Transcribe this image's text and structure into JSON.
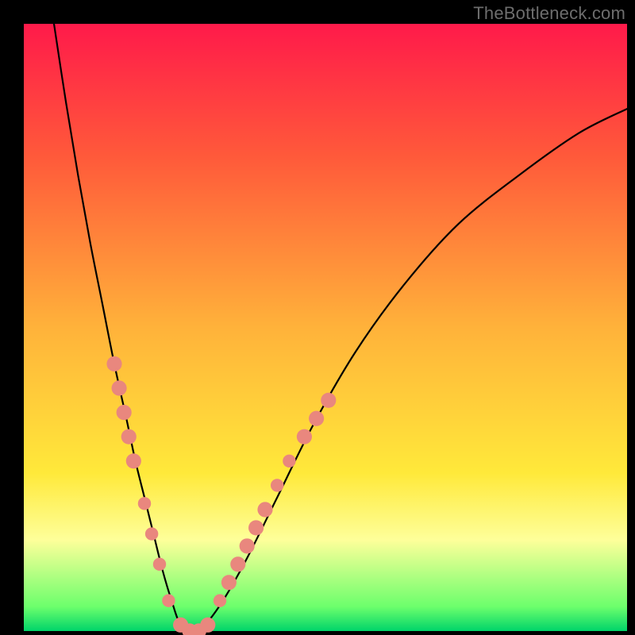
{
  "watermark": "TheBottleneck.com",
  "colors": {
    "top": "#ff1a4a",
    "upper": "#ff5a3a",
    "mid": "#ffb23a",
    "low": "#ffe93a",
    "pale": "#feff9a",
    "green1": "#6cff6c",
    "green2": "#00d46a",
    "curve": "#000000",
    "dot": "#e9877e"
  },
  "chart_data": {
    "type": "line",
    "title": "",
    "xlabel": "",
    "ylabel": "",
    "xlim": [
      0,
      100
    ],
    "ylim": [
      0,
      100
    ],
    "grid": false,
    "legend": false,
    "annotations": [],
    "series": [
      {
        "name": "bottleneck-curve",
        "x": [
          5,
          7,
          9,
          11,
          13,
          15,
          17,
          18.5,
          20,
          21.5,
          23,
          24.5,
          26,
          28,
          30,
          33,
          37,
          42,
          48,
          55,
          63,
          72,
          82,
          92,
          100
        ],
        "values": [
          100,
          87,
          75,
          64,
          54,
          44,
          35,
          28,
          22,
          16,
          10,
          5,
          1,
          0,
          1,
          5,
          12,
          22,
          34,
          46,
          57,
          67,
          75,
          82,
          86
        ]
      }
    ],
    "markers": [
      {
        "series": "bottleneck-curve",
        "x": 15.0,
        "y": 44,
        "r": 1.4
      },
      {
        "series": "bottleneck-curve",
        "x": 15.8,
        "y": 40,
        "r": 1.4
      },
      {
        "series": "bottleneck-curve",
        "x": 16.6,
        "y": 36,
        "r": 1.4
      },
      {
        "series": "bottleneck-curve",
        "x": 17.4,
        "y": 32,
        "r": 1.4
      },
      {
        "series": "bottleneck-curve",
        "x": 18.2,
        "y": 28,
        "r": 1.4
      },
      {
        "series": "bottleneck-curve",
        "x": 20.0,
        "y": 21,
        "r": 1.2
      },
      {
        "series": "bottleneck-curve",
        "x": 21.2,
        "y": 16,
        "r": 1.2
      },
      {
        "series": "bottleneck-curve",
        "x": 22.5,
        "y": 11,
        "r": 1.2
      },
      {
        "series": "bottleneck-curve",
        "x": 24.0,
        "y": 5,
        "r": 1.2
      },
      {
        "series": "bottleneck-curve",
        "x": 26.0,
        "y": 1,
        "r": 1.4
      },
      {
        "series": "bottleneck-curve",
        "x": 27.5,
        "y": 0,
        "r": 1.4
      },
      {
        "series": "bottleneck-curve",
        "x": 29.0,
        "y": 0,
        "r": 1.4
      },
      {
        "series": "bottleneck-curve",
        "x": 30.5,
        "y": 1,
        "r": 1.4
      },
      {
        "series": "bottleneck-curve",
        "x": 32.5,
        "y": 5,
        "r": 1.2
      },
      {
        "series": "bottleneck-curve",
        "x": 34.0,
        "y": 8,
        "r": 1.4
      },
      {
        "series": "bottleneck-curve",
        "x": 35.5,
        "y": 11,
        "r": 1.4
      },
      {
        "series": "bottleneck-curve",
        "x": 37.0,
        "y": 14,
        "r": 1.4
      },
      {
        "series": "bottleneck-curve",
        "x": 38.5,
        "y": 17,
        "r": 1.4
      },
      {
        "series": "bottleneck-curve",
        "x": 40.0,
        "y": 20,
        "r": 1.4
      },
      {
        "series": "bottleneck-curve",
        "x": 42.0,
        "y": 24,
        "r": 1.2
      },
      {
        "series": "bottleneck-curve",
        "x": 44.0,
        "y": 28,
        "r": 1.2
      },
      {
        "series": "bottleneck-curve",
        "x": 46.5,
        "y": 32,
        "r": 1.4
      },
      {
        "series": "bottleneck-curve",
        "x": 48.5,
        "y": 35,
        "r": 1.4
      },
      {
        "series": "bottleneck-curve",
        "x": 50.5,
        "y": 38,
        "r": 1.4
      }
    ]
  }
}
